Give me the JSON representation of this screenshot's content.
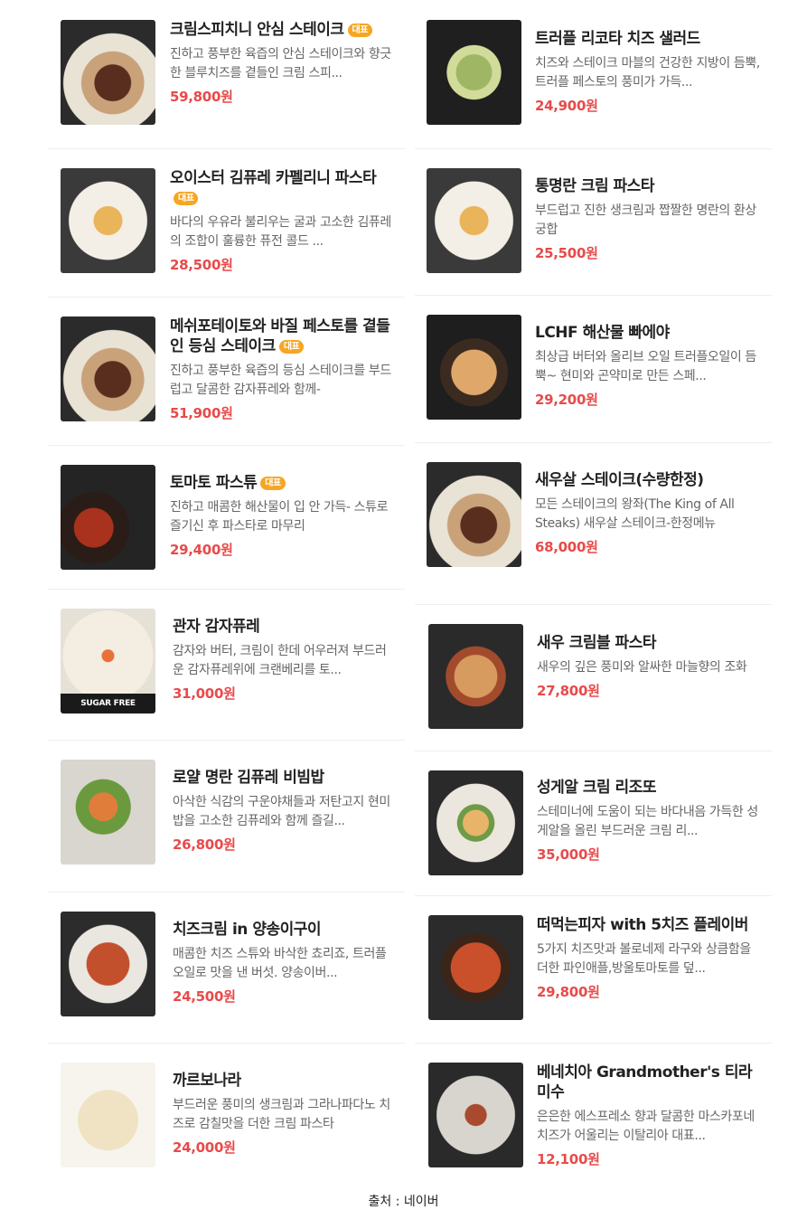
{
  "badge_label": "대표",
  "colors": {
    "price": "#e84a4a",
    "badge": "#f5a623"
  },
  "left": [
    {
      "name": "크림스피치니 안심 스테이크",
      "badge": true,
      "desc": "진하고 풍부한 육즙의 안심 스테이크와 향긋한 블루치즈를 곁들인 크림 스피...",
      "price": "59,800원",
      "image": "steak-plate"
    },
    {
      "name": "오이스터 김퓨레 카펠리니 파스타",
      "badge": true,
      "desc": "바다의 우유라 불리우는 굴과 고소한 김퓨레의 조합이 훌륭한 퓨전 콜드 ...",
      "price": "28,500원",
      "image": "pasta-plate"
    },
    {
      "name": "메쉬포테이토와 바질 페스토를 곁들인 등심 스테이크",
      "badge": true,
      "desc": "진하고 풍부한 육즙의 등심 스테이크를 부드럽고 달콤한 감자퓨레와 함께-",
      "price": "51,900원",
      "image": "steak-plate"
    },
    {
      "name": "토마토 파스튜",
      "badge": true,
      "desc": "진하고 매콤한 해산물이 입 안 가득- 스튜로 즐기신 후 파스타로 마무리",
      "price": "29,400원",
      "image": "stew-pot"
    },
    {
      "name": "관자 감자퓨레",
      "badge": false,
      "desc": "감자와 버터, 크림이 한데 어우러져 부드러운 감자퓨레위에 크랜베리를 토...",
      "price": "31,000원",
      "image": "scallop-plate",
      "sugar": "SUGAR FREE"
    },
    {
      "name": "로얄 명란 김퓨레 비빔밥",
      "badge": false,
      "desc": "아삭한 식감의 구운야채들과 저탄고지 현미밥을 고소한 김퓨레와 함께 즐길...",
      "price": "26,800원",
      "image": "rice-bowl"
    },
    {
      "name": "치즈크림 in 양송이구이",
      "badge": false,
      "desc": "매콤한 치즈 스튜와 바삭한 쵸리죠, 트러플 오일로 맛을 낸 버섯. 양송이버...",
      "price": "24,500원",
      "image": "mushroom-plate"
    },
    {
      "name": "까르보나라",
      "badge": false,
      "desc": "부드러운 풍미의 생크림과 그라나파다노 치즈로 감칠맛을 더한 크림 파스타",
      "price": "24,000원",
      "image": "carbonara-plate"
    }
  ],
  "right": [
    {
      "name": "트러플 리코타 치즈 샐러드",
      "badge": false,
      "desc": "치즈와 스테이크 마블의 건강한 지방이 듬뿍, 트러플 페스토의 풍미가 가득...",
      "price": "24,900원",
      "image": "salad-bowl"
    },
    {
      "name": "통명란 크림 파스타",
      "badge": false,
      "desc": "부드럽고 진한 생크림과 짭짤한 명란의 환상 궁합",
      "price": "25,500원",
      "image": "pasta-plate"
    },
    {
      "name": "LCHF 해산물 빠에야",
      "badge": false,
      "desc": "최상급 버터와 올리브 오일 트러플오일이 듬뿍~ 현미와 곤약미로 만든 스페...",
      "price": "29,200원",
      "image": "paella-pan"
    },
    {
      "name": "새우살 스테이크(수량한정)",
      "badge": false,
      "desc": "모든 스테이크의 왕좌(The King of All Steaks) 새우살 스테이크-한정메뉴",
      "price": "68,000원",
      "image": "steak-plate"
    },
    {
      "name": "새우 크림블 파스타",
      "badge": false,
      "desc": "새우의 깊은 풍미와 알싸한 마늘향의 조화",
      "price": "27,800원",
      "image": "shrimp-pasta"
    },
    {
      "name": "성게알 크림 리조또",
      "badge": false,
      "desc": "스테미너에 도움이 되는 바다내음 가득한 성게알을 올린 부드러운 크림 리...",
      "price": "35,000원",
      "image": "risotto-plate"
    },
    {
      "name": "떠먹는피자 with 5치즈 플레이버",
      "badge": false,
      "desc": "5가지 치즈맛과 볼로네제 라구와 상큼함을 더한 파인애플,방울토마토를 덮...",
      "price": "29,800원",
      "image": "pizza-pan"
    },
    {
      "name": "베네치아 Grandmother's 티라미수",
      "badge": false,
      "desc": "은은한 에스프레소 향과 달콤한 마스카포네 치즈가 어울리는 이탈리아 대표...",
      "price": "12,100원",
      "image": "tiramisu-plate"
    }
  ],
  "footer": "출처 : 네이버"
}
